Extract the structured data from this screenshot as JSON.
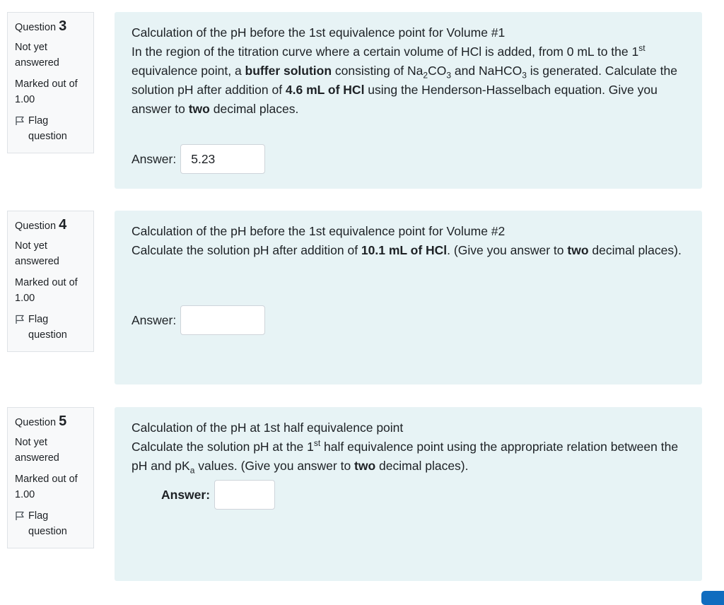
{
  "colors": {
    "info_bg": "#f8f9fa",
    "formulation_bg": "#e7f3f5",
    "primary": "#0f6cbf"
  },
  "questions": [
    {
      "label": "Question",
      "number": "3",
      "state": "Not yet answered",
      "grade": "Marked out of 1.00",
      "flag": "Flag question",
      "title": "Calculation of the pH before the 1st equivalence point for Volume #1",
      "body": {
        "t1": "In the region of the titration curve where a certain volume of HCl is added, from 0 mL to the 1",
        "sup1": "st",
        "t2": " equivalence point, a ",
        "b1": "buffer solution",
        "t3": " consisting of Na",
        "sub1": "2",
        "t4": "CO",
        "sub2": "3",
        "t5": " and NaHCO",
        "sub3": "3",
        "t6": " is generated. Calculate the solution pH after addition of ",
        "b2": "4.6 mL of HCl",
        "t7": " using the Henderson-Hasselbach equation. Give you answer to ",
        "b3": "two",
        "t8": " decimal places."
      },
      "answer_label": "Answer:",
      "answer_value": "5.23"
    },
    {
      "label": "Question",
      "number": "4",
      "state": "Not yet answered",
      "grade": "Marked out of 1.00",
      "flag": "Flag question",
      "title": "Calculation of the pH before the 1st equivalence point for Volume #2",
      "body": {
        "t1": "Calculate the solution pH after addition of ",
        "b1": "10.1 mL of HCl",
        "t2": ". (Give you answer to ",
        "b2": "two",
        "t3": " decimal places)."
      },
      "answer_label": "Answer:",
      "answer_value": ""
    },
    {
      "label": "Question",
      "number": "5",
      "state": "Not yet answered",
      "grade": "Marked out of 1.00",
      "flag": "Flag question",
      "title": "Calculation of the pH at 1st half equivalence point",
      "body": {
        "t1": "Calculate the solution pH at the 1",
        "sup1": "st",
        "t2": " half equivalence point using the appropriate relation between the pH and pK",
        "sub1": "a",
        "t3": " values. (Give you answer to ",
        "b1": "two",
        "t4": " decimal places)."
      },
      "answer_label": "Answer:",
      "answer_value": ""
    }
  ]
}
